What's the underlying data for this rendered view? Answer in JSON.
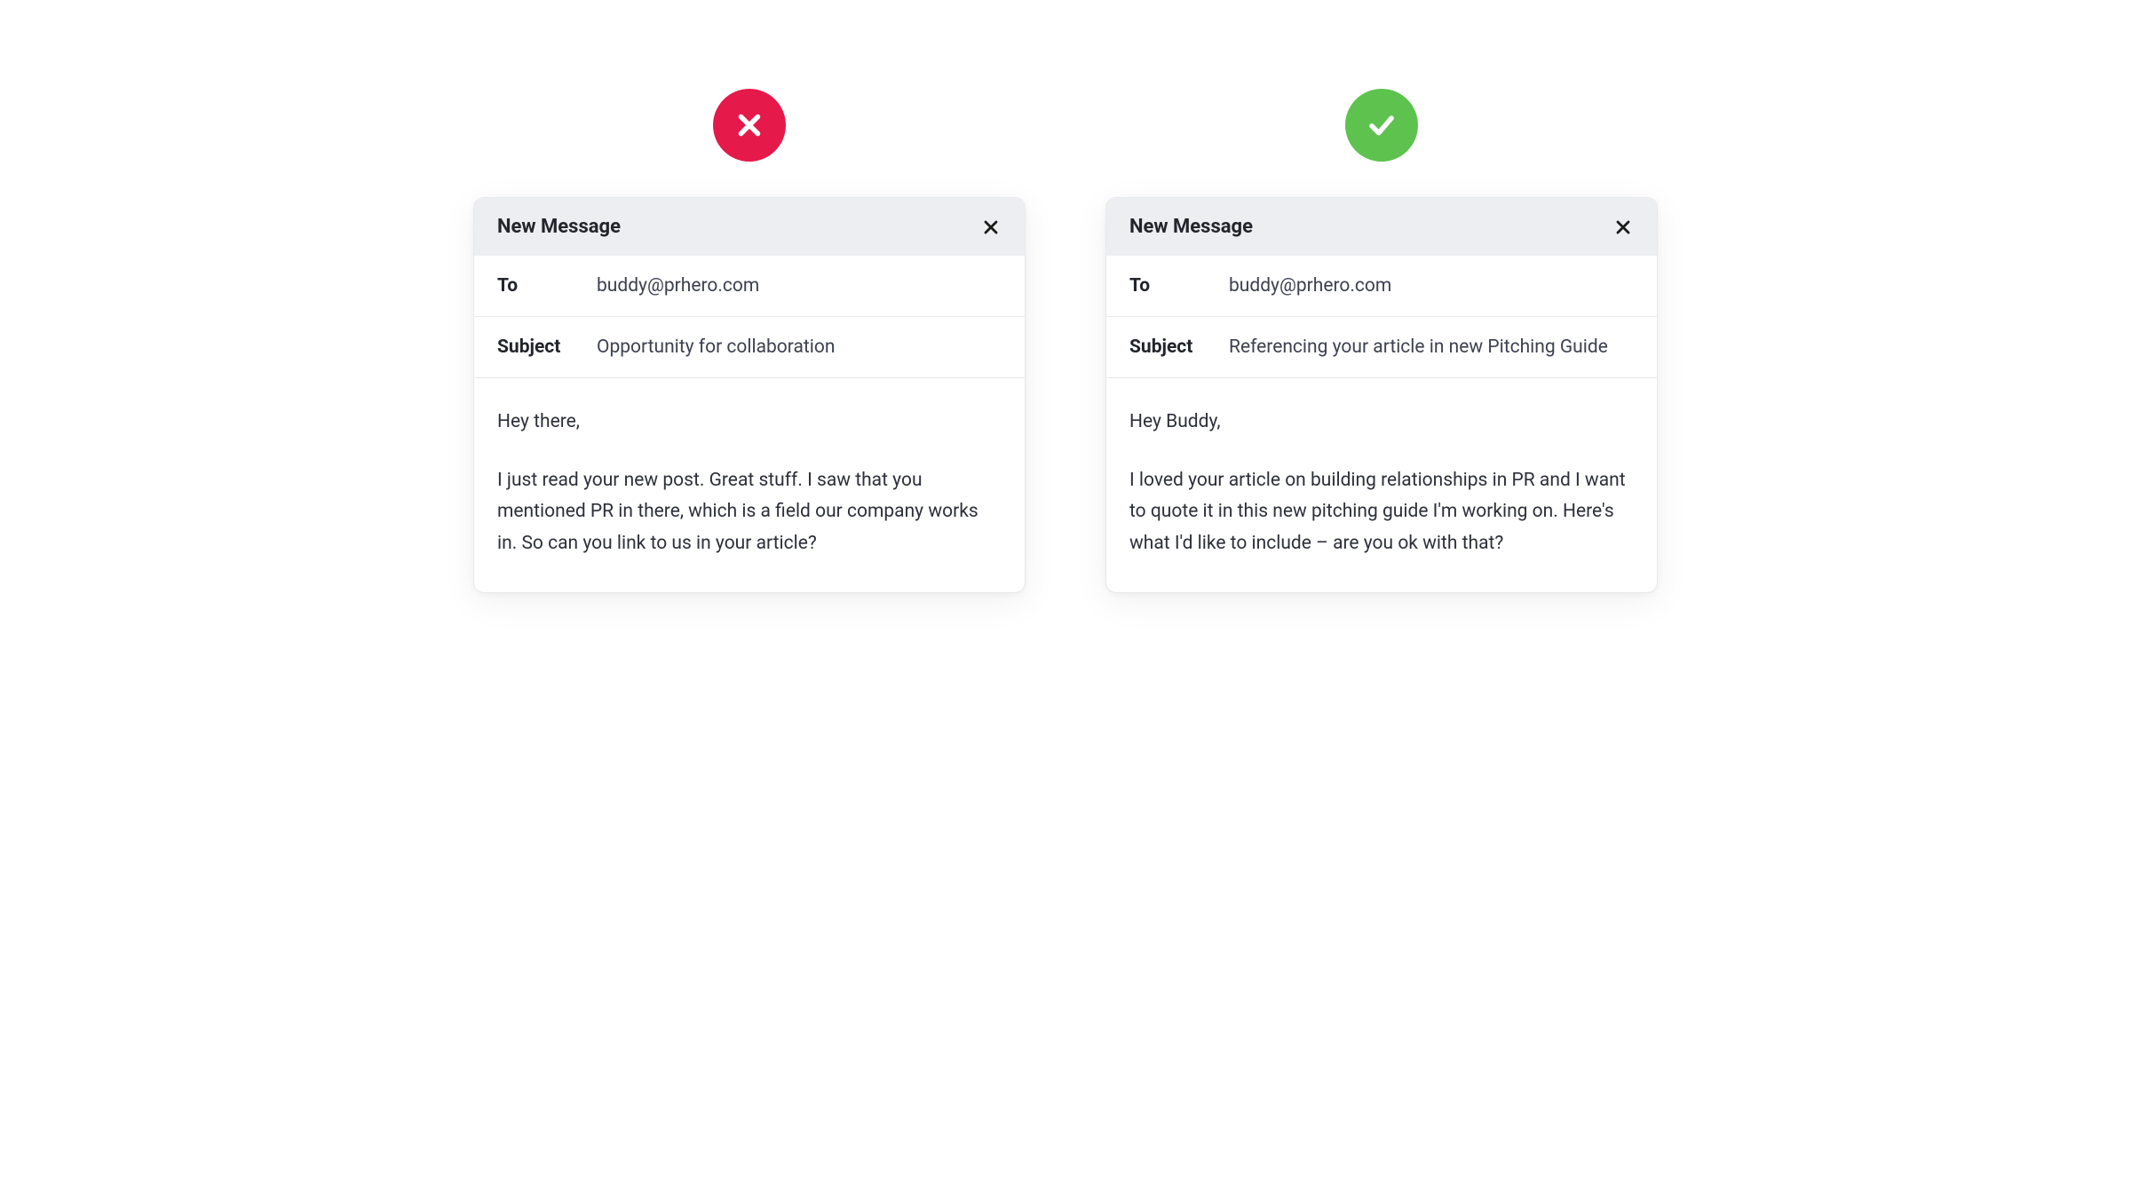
{
  "bad": {
    "header_title": "New Message",
    "to_label": "To",
    "to_value": "buddy@prhero.com",
    "subject_label": "Subject",
    "subject_value": "Opportunity for collaboration",
    "greeting": "Hey there,",
    "body": "I just read your new post. Great stuff. I saw that you mentioned PR in there, which is a field our company works in. So can you link to us in your article?"
  },
  "good": {
    "header_title": "New Message",
    "to_label": "To",
    "to_value": "buddy@prhero.com",
    "subject_label": "Subject",
    "subject_value": "Referencing your article in new Pitching Guide",
    "greeting": "Hey Buddy,",
    "body": "I loved your article on building relationships in PR and I want to quote it in this new pitching guide I'm working on. Here's what I'd like to include – are you ok with that?"
  }
}
